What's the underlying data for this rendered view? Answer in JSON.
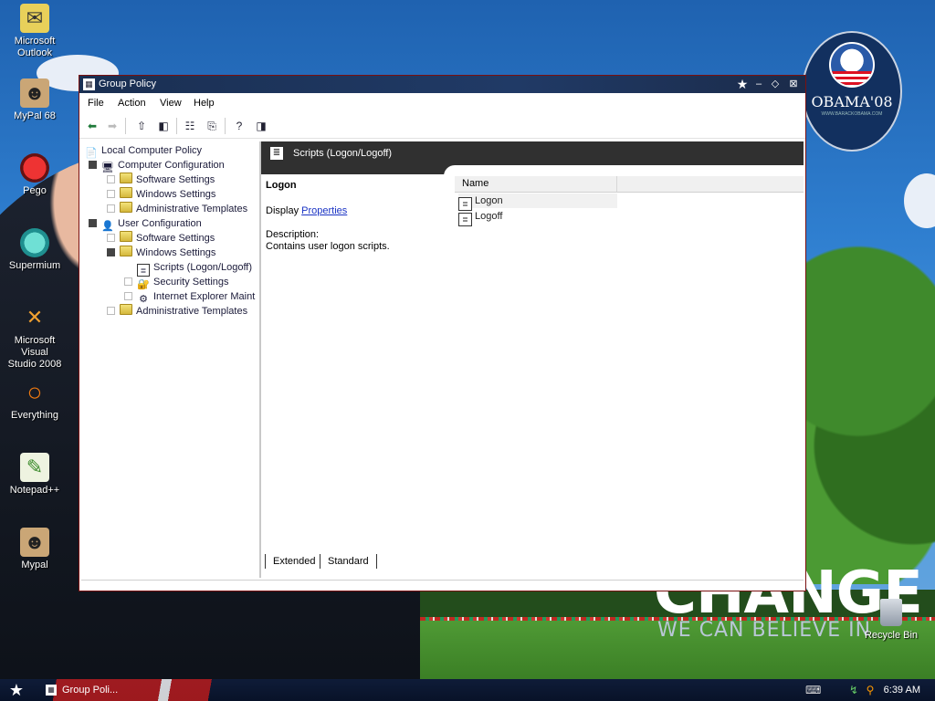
{
  "desktop": {
    "icons": [
      {
        "label": "Microsoft\nOutlook",
        "icon": "outlook-icon"
      },
      {
        "label": "MyPal 68",
        "icon": "mypal-icon"
      },
      {
        "label": "Pego",
        "icon": "pego-icon"
      },
      {
        "label": "Supermium",
        "icon": "supermium-icon"
      },
      {
        "label": "Microsoft Visual\nStudio 2008",
        "icon": "visual-studio-icon"
      },
      {
        "label": "Everything",
        "icon": "everything-icon"
      },
      {
        "label": "Notepad++",
        "icon": "notepadpp-icon"
      },
      {
        "label": "Mypal",
        "icon": "mypal-icon"
      }
    ],
    "recycle_bin": "Recycle Bin",
    "wallpaper": {
      "logo_text": "OBAMA'08",
      "logo_sub": "WWW.BARACKOBAMA.COM",
      "headline": "CHANGE",
      "tagline": "WE CAN BELIEVE IN"
    }
  },
  "window": {
    "title": "Group Policy",
    "menu": [
      "File",
      "Action",
      "View",
      "Help"
    ],
    "toolbar_icons": [
      "back-arrow-icon",
      "forward-arrow-icon",
      "up-folder-icon",
      "show-hide-tree-icon",
      "properties-icon",
      "export-list-icon",
      "help-icon",
      "show-hide-action-pane-icon"
    ],
    "tree": [
      {
        "label": "Local Computer Policy",
        "level": 0,
        "exp": "none",
        "icon": "policy-icon"
      },
      {
        "label": "Computer Configuration",
        "level": 1,
        "exp": "filled",
        "icon": "computer-icon"
      },
      {
        "label": "Software Settings",
        "level": 2,
        "exp": "hollow",
        "icon": "folder-icon"
      },
      {
        "label": "Windows Settings",
        "level": 2,
        "exp": "hollow",
        "icon": "folder-icon"
      },
      {
        "label": "Administrative Templates",
        "level": 2,
        "exp": "hollow",
        "icon": "folder-icon"
      },
      {
        "label": "User Configuration",
        "level": 1,
        "exp": "filled",
        "icon": "user-icon"
      },
      {
        "label": "Software Settings",
        "level": 2,
        "exp": "hollow",
        "icon": "folder-icon"
      },
      {
        "label": "Windows Settings",
        "level": 2,
        "exp": "filled",
        "icon": "folder-icon"
      },
      {
        "label": "Scripts (Logon/Logoff)",
        "level": 3,
        "exp": "none",
        "icon": "script-icon"
      },
      {
        "label": "Security Settings",
        "level": 3,
        "exp": "hollow",
        "icon": "security-icon"
      },
      {
        "label": "Internet Explorer Maint",
        "level": 3,
        "exp": "hollow",
        "icon": "ie-maintenance-icon"
      },
      {
        "label": "Administrative Templates",
        "level": 2,
        "exp": "hollow",
        "icon": "folder-icon"
      }
    ],
    "right_header": "Scripts (Logon/Logoff)",
    "detail": {
      "title": "Logon",
      "display_prefix": "Display",
      "display_link": "Properties",
      "description_label": "Description:",
      "description_text": "Contains user logon scripts."
    },
    "list": {
      "column": "Name",
      "items": [
        "Logon",
        "Logoff"
      ]
    },
    "tabs": [
      "Extended",
      "Standard"
    ]
  },
  "taskbar": {
    "task_label": "Group Poli...",
    "clock": "6:39 AM"
  }
}
